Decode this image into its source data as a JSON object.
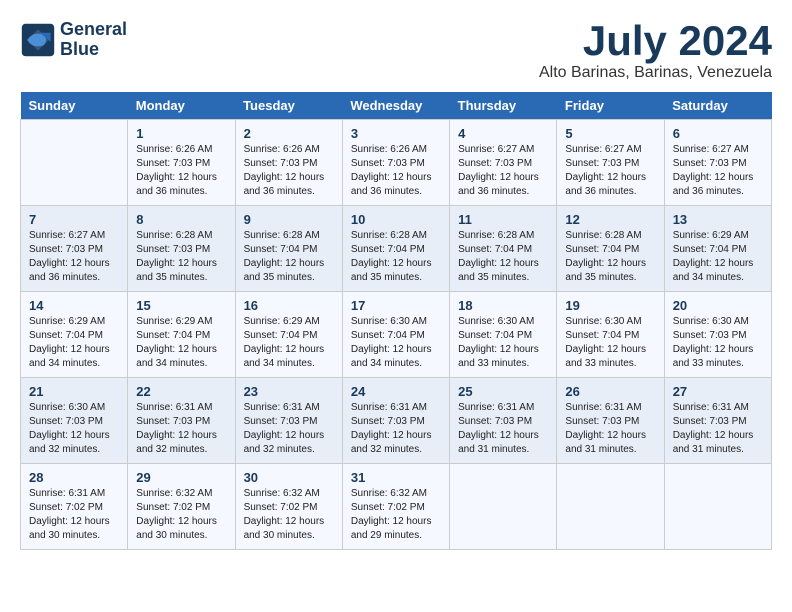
{
  "logo": {
    "line1": "General",
    "line2": "Blue"
  },
  "title": "July 2024",
  "subtitle": "Alto Barinas, Barinas, Venezuela",
  "weekdays": [
    "Sunday",
    "Monday",
    "Tuesday",
    "Wednesday",
    "Thursday",
    "Friday",
    "Saturday"
  ],
  "weeks": [
    [
      {
        "day": "",
        "info": ""
      },
      {
        "day": "1",
        "info": "Sunrise: 6:26 AM\nSunset: 7:03 PM\nDaylight: 12 hours\nand 36 minutes."
      },
      {
        "day": "2",
        "info": "Sunrise: 6:26 AM\nSunset: 7:03 PM\nDaylight: 12 hours\nand 36 minutes."
      },
      {
        "day": "3",
        "info": "Sunrise: 6:26 AM\nSunset: 7:03 PM\nDaylight: 12 hours\nand 36 minutes."
      },
      {
        "day": "4",
        "info": "Sunrise: 6:27 AM\nSunset: 7:03 PM\nDaylight: 12 hours\nand 36 minutes."
      },
      {
        "day": "5",
        "info": "Sunrise: 6:27 AM\nSunset: 7:03 PM\nDaylight: 12 hours\nand 36 minutes."
      },
      {
        "day": "6",
        "info": "Sunrise: 6:27 AM\nSunset: 7:03 PM\nDaylight: 12 hours\nand 36 minutes."
      }
    ],
    [
      {
        "day": "7",
        "info": "Sunrise: 6:27 AM\nSunset: 7:03 PM\nDaylight: 12 hours\nand 36 minutes."
      },
      {
        "day": "8",
        "info": "Sunrise: 6:28 AM\nSunset: 7:03 PM\nDaylight: 12 hours\nand 35 minutes."
      },
      {
        "day": "9",
        "info": "Sunrise: 6:28 AM\nSunset: 7:04 PM\nDaylight: 12 hours\nand 35 minutes."
      },
      {
        "day": "10",
        "info": "Sunrise: 6:28 AM\nSunset: 7:04 PM\nDaylight: 12 hours\nand 35 minutes."
      },
      {
        "day": "11",
        "info": "Sunrise: 6:28 AM\nSunset: 7:04 PM\nDaylight: 12 hours\nand 35 minutes."
      },
      {
        "day": "12",
        "info": "Sunrise: 6:28 AM\nSunset: 7:04 PM\nDaylight: 12 hours\nand 35 minutes."
      },
      {
        "day": "13",
        "info": "Sunrise: 6:29 AM\nSunset: 7:04 PM\nDaylight: 12 hours\nand 34 minutes."
      }
    ],
    [
      {
        "day": "14",
        "info": "Sunrise: 6:29 AM\nSunset: 7:04 PM\nDaylight: 12 hours\nand 34 minutes."
      },
      {
        "day": "15",
        "info": "Sunrise: 6:29 AM\nSunset: 7:04 PM\nDaylight: 12 hours\nand 34 minutes."
      },
      {
        "day": "16",
        "info": "Sunrise: 6:29 AM\nSunset: 7:04 PM\nDaylight: 12 hours\nand 34 minutes."
      },
      {
        "day": "17",
        "info": "Sunrise: 6:30 AM\nSunset: 7:04 PM\nDaylight: 12 hours\nand 34 minutes."
      },
      {
        "day": "18",
        "info": "Sunrise: 6:30 AM\nSunset: 7:04 PM\nDaylight: 12 hours\nand 33 minutes."
      },
      {
        "day": "19",
        "info": "Sunrise: 6:30 AM\nSunset: 7:04 PM\nDaylight: 12 hours\nand 33 minutes."
      },
      {
        "day": "20",
        "info": "Sunrise: 6:30 AM\nSunset: 7:03 PM\nDaylight: 12 hours\nand 33 minutes."
      }
    ],
    [
      {
        "day": "21",
        "info": "Sunrise: 6:30 AM\nSunset: 7:03 PM\nDaylight: 12 hours\nand 32 minutes."
      },
      {
        "day": "22",
        "info": "Sunrise: 6:31 AM\nSunset: 7:03 PM\nDaylight: 12 hours\nand 32 minutes."
      },
      {
        "day": "23",
        "info": "Sunrise: 6:31 AM\nSunset: 7:03 PM\nDaylight: 12 hours\nand 32 minutes."
      },
      {
        "day": "24",
        "info": "Sunrise: 6:31 AM\nSunset: 7:03 PM\nDaylight: 12 hours\nand 32 minutes."
      },
      {
        "day": "25",
        "info": "Sunrise: 6:31 AM\nSunset: 7:03 PM\nDaylight: 12 hours\nand 31 minutes."
      },
      {
        "day": "26",
        "info": "Sunrise: 6:31 AM\nSunset: 7:03 PM\nDaylight: 12 hours\nand 31 minutes."
      },
      {
        "day": "27",
        "info": "Sunrise: 6:31 AM\nSunset: 7:03 PM\nDaylight: 12 hours\nand 31 minutes."
      }
    ],
    [
      {
        "day": "28",
        "info": "Sunrise: 6:31 AM\nSunset: 7:02 PM\nDaylight: 12 hours\nand 30 minutes."
      },
      {
        "day": "29",
        "info": "Sunrise: 6:32 AM\nSunset: 7:02 PM\nDaylight: 12 hours\nand 30 minutes."
      },
      {
        "day": "30",
        "info": "Sunrise: 6:32 AM\nSunset: 7:02 PM\nDaylight: 12 hours\nand 30 minutes."
      },
      {
        "day": "31",
        "info": "Sunrise: 6:32 AM\nSunset: 7:02 PM\nDaylight: 12 hours\nand 29 minutes."
      },
      {
        "day": "",
        "info": ""
      },
      {
        "day": "",
        "info": ""
      },
      {
        "day": "",
        "info": ""
      }
    ]
  ]
}
